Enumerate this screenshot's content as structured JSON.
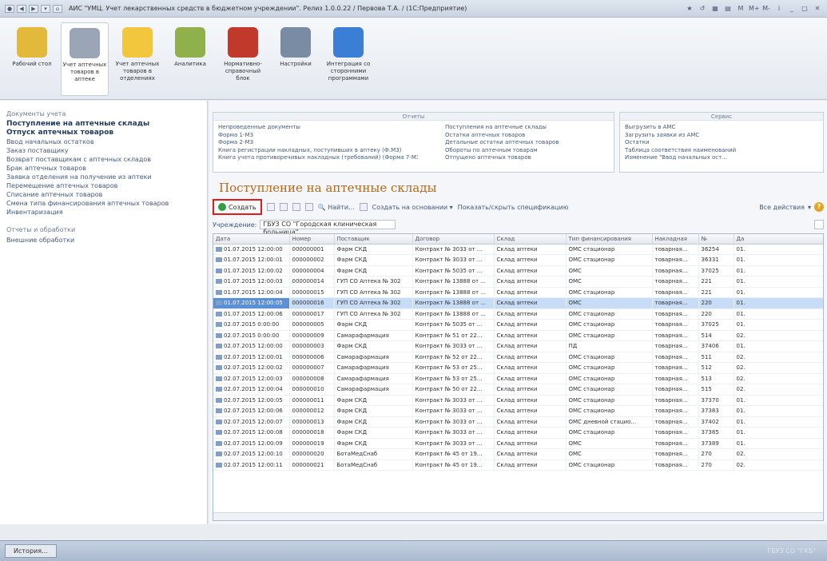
{
  "window": {
    "title": "АИС \"УМЦ. Учет лекарственных средств в бюджетном учреждении\". Релиз 1.0.0.22 / Первова Т.А. / (1С:Предприятие)"
  },
  "sections": [
    {
      "label": "Рабочий стол",
      "active": false,
      "color": "#e2b93b"
    },
    {
      "label": "Учет аптечных товаров в аптеке",
      "active": true,
      "color": "#9aa5b5"
    },
    {
      "label": "Учет аптечных товаров в отделениях",
      "active": false,
      "color": "#f2c73e"
    },
    {
      "label": "Аналитика",
      "active": false,
      "color": "#8fb04a"
    },
    {
      "label": "Нормативно-справочный блок",
      "active": false,
      "color": "#c0392b"
    },
    {
      "label": "Настройки",
      "active": false,
      "color": "#7a8ca3"
    },
    {
      "label": "Интеграция со сторонними программами",
      "active": false,
      "color": "#3a7fd5"
    }
  ],
  "left_panel": {
    "heading": "Документы учета",
    "items": [
      {
        "label": "Поступление на аптечные склады",
        "bold": true
      },
      {
        "label": "Отпуск аптечных товаров",
        "bold": true
      },
      {
        "label": "Ввод начальных остатков",
        "bold": false
      },
      {
        "label": "Заказ поставщику",
        "bold": false
      },
      {
        "label": "Возврат поставщикам с аптечных складов",
        "bold": false
      },
      {
        "label": "Брак аптечных товаров",
        "bold": false
      },
      {
        "label": "Заявка отделения на получение из аптеки",
        "bold": false
      },
      {
        "label": "Перемещение аптечных товаров",
        "bold": false
      },
      {
        "label": "Списание аптечных товаров",
        "bold": false
      },
      {
        "label": "Смена типа финансирования аптечных товаров",
        "bold": false
      },
      {
        "label": "Инвентаризация",
        "bold": false
      }
    ],
    "heading2": "Отчеты и обработки",
    "items2": [
      {
        "label": "Внешние обработки"
      }
    ]
  },
  "reports_box": {
    "title": "Отчеты",
    "col1": [
      "Непроведенные документы",
      "Форма 1-МЗ",
      "Форма 2-МЗ",
      "Книга регистрации накладных, поступивших в аптеку (Ф.МЗ)",
      "Книга учета противоречивых накладных (требований) (Форма 7-МЗ)"
    ],
    "col2": [
      "Поступления на аптечные склады",
      "Остатки аптечных товаров",
      "Детальные остатки аптечных товаров",
      "Обороты по аптечным товарам",
      "Отпущено аптечных товаров"
    ]
  },
  "service_box": {
    "title": "Сервис",
    "items": [
      "Выгрузить в АМС",
      "Загрузить заявки из АМС",
      "Остатки",
      "Таблица соответствия наименований",
      "Изменение \"Ввод начальных ост..."
    ]
  },
  "document_list": {
    "title": "Поступление на аптечные склады",
    "toolbar": {
      "create": "Создать",
      "find": "Найти...",
      "create_based": "Создать на основании",
      "toggle_spec": "Показать/скрыть спецификацию",
      "all_actions": "Все действия"
    },
    "filter": {
      "label": "Учреждение:",
      "value": "ГБУЗ СО \"Городская клиническая больница\""
    },
    "columns": [
      "Дата",
      "Номер",
      "Поставщик",
      "Договор",
      "Склад",
      "Тип финансирования",
      "Накладная",
      "№",
      "Да"
    ],
    "rows": [
      [
        "01.07.2015 12:00:00",
        "000000001",
        "Фарм СКД",
        "Контракт № 3033 от ...",
        "Склад аптеки",
        "ОМС стационар",
        "товарная...",
        "36254",
        "01."
      ],
      [
        "01.07.2015 12:00:01",
        "000000002",
        "Фарм СКД",
        "Контракт № 3033 от ...",
        "Склад аптеки",
        "ОМС стационар",
        "товарная...",
        "36331",
        "01."
      ],
      [
        "01.07.2015 12:00:02",
        "000000004",
        "Фарм СКД",
        "Контракт № 5035 от ...",
        "Склад аптеки",
        "ОМС",
        "товарная...",
        "37025",
        "01."
      ],
      [
        "01.07.2015 12:00:03",
        "000000014",
        "ГУП СО Аптека № 302",
        "Контракт № 13888 от ...",
        "Склад аптеки",
        "ОМС",
        "товарная...",
        "221",
        "01."
      ],
      [
        "01.07.2015 12:00:04",
        "000000015",
        "ГУП СО Аптека № 302",
        "Контракт № 13888 от ...",
        "Склад аптеки",
        "ОМС стационар",
        "товарная...",
        "221",
        "01."
      ],
      [
        "01.07.2015 12:00:05",
        "000000016",
        "ГУП СО Аптека № 302",
        "Контракт № 13888 от ...",
        "Склад аптеки",
        "ОМС",
        "товарная...",
        "220",
        "01."
      ],
      [
        "01.07.2015 12:00:06",
        "000000017",
        "ГУП СО Аптека № 302",
        "Контракт № 13888 от ...",
        "Склад аптеки",
        "ОМС стационар",
        "товарная...",
        "220",
        "01."
      ],
      [
        "02.07.2015 0:00:00",
        "000000005",
        "Фарм СКД",
        "Контракт № 5035 от ...",
        "Склад аптеки",
        "ОМС стационар",
        "товарная...",
        "37025",
        "01."
      ],
      [
        "02.07.2015 0:00:00",
        "000000009",
        "Самарафармация",
        "Контракт № 51 от 22...",
        "Склад аптеки",
        "ОМС стационар",
        "товарная...",
        "514",
        "02."
      ],
      [
        "02.07.2015 12:00:00",
        "000000003",
        "Фарм СКД",
        "Контракт № 3033 от ...",
        "Склад аптеки",
        "ПД",
        "товарная...",
        "37406",
        "01."
      ],
      [
        "02.07.2015 12:00:01",
        "000000006",
        "Самарафармация",
        "Контракт № 52 от 22...",
        "Склад аптеки",
        "ОМС стационар",
        "товарная...",
        "511",
        "02."
      ],
      [
        "02.07.2015 12:00:02",
        "000000007",
        "Самарафармация",
        "Контракт № 53 от 25...",
        "Склад аптеки",
        "ОМС стационар",
        "товарная...",
        "512",
        "02."
      ],
      [
        "02.07.2015 12:00:03",
        "000000008",
        "Самарафармация",
        "Контракт № 53 от 25...",
        "Склад аптеки",
        "ОМС стационар",
        "товарная...",
        "513",
        "02."
      ],
      [
        "02.07.2015 12:00:04",
        "000000010",
        "Самарафармация",
        "Контракт № 50 от 22...",
        "Склад аптеки",
        "ОМС стационар",
        "товарная...",
        "515",
        "02."
      ],
      [
        "02.07.2015 12:00:05",
        "000000011",
        "Фарм СКД",
        "Контракт № 3033 от ...",
        "Склад аптеки",
        "ОМС стационар",
        "товарная...",
        "37370",
        "01."
      ],
      [
        "02.07.2015 12:00:06",
        "000000012",
        "Фарм СКД",
        "Контракт № 3033 от ...",
        "Склад аптеки",
        "ОМС стационар",
        "товарная...",
        "37383",
        "01."
      ],
      [
        "02.07.2015 12:00:07",
        "000000013",
        "Фарм СКД",
        "Контракт № 3033 от ...",
        "Склад аптеки",
        "ОМС дневной стацио...",
        "товарная...",
        "37402",
        "01."
      ],
      [
        "02.07.2015 12:00:08",
        "000000018",
        "Фарм СКД",
        "Контракт № 3033 от ...",
        "Склад аптеки",
        "ОМС стационар",
        "товарная...",
        "37385",
        "01."
      ],
      [
        "02.07.2015 12:00:09",
        "000000019",
        "Фарм СКД",
        "Контракт № 3033 от ...",
        "Склад аптеки",
        "ОМС",
        "товарная...",
        "37389",
        "01."
      ],
      [
        "02.07.2015 12:00:10",
        "000000020",
        "БотаМедСнаб",
        "Контракт № 45 от 19...",
        "Склад аптеки",
        "ОМС",
        "товарная...",
        "270",
        "02."
      ],
      [
        "02.07.2015 12:00:11",
        "000000021",
        "БотаМедСнаб",
        "Контракт № 45 от 19...",
        "Склад аптеки",
        "ОМС стационар",
        "товарная...",
        "270",
        "02."
      ]
    ],
    "selected_row": 5
  },
  "statusbar": {
    "history": "История...",
    "right": "ГБУЗ СО \"ГКБ\""
  }
}
